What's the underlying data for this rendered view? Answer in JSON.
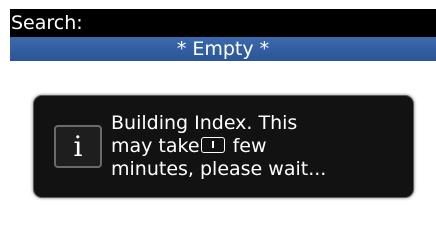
{
  "search": {
    "label": "Search:"
  },
  "list": {
    "empty_label": "* Empty *"
  },
  "dialog": {
    "icon": "info-icon",
    "icon_glyph": "i",
    "line1": "Building Index. This",
    "line2_before": "may take",
    "line2_after": " few",
    "line3": "minutes, please wait..."
  },
  "colors": {
    "header": "#2b5596",
    "dialog_bg": "#121212"
  }
}
